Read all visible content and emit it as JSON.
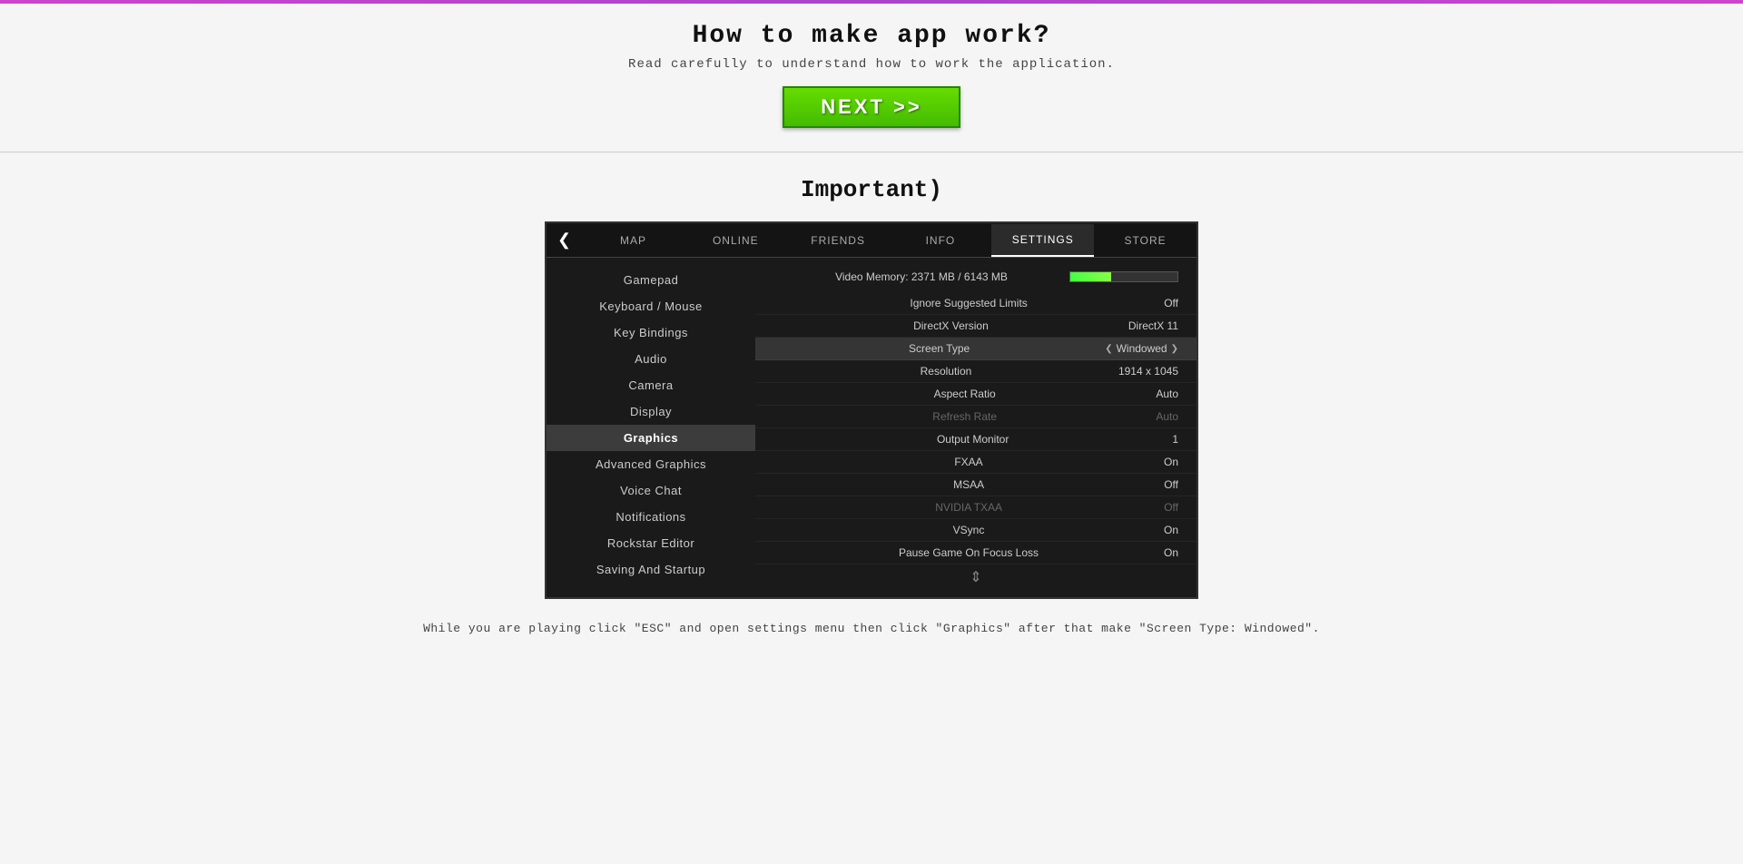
{
  "page": {
    "border_color": "#cc44cc",
    "title": "How to make app work?",
    "subtitle": "Read carefully to understand how to work the application.",
    "next_button": "NEXT >>",
    "section_title": "Important)",
    "instruction": "While you are playing click \"ESC\" and open settings menu then click \"Graphics\" after that make \"Screen Type: Windowed\"."
  },
  "nav": {
    "back_arrow": "❮",
    "items": [
      {
        "label": "MAP",
        "active": false
      },
      {
        "label": "ONLINE",
        "active": false
      },
      {
        "label": "FRIENDS",
        "active": false
      },
      {
        "label": "INFO",
        "active": false
      },
      {
        "label": "SETTINGS",
        "active": true
      },
      {
        "label": "STORE",
        "active": false
      }
    ]
  },
  "sidebar": {
    "items": [
      {
        "label": "Gamepad",
        "active": false
      },
      {
        "label": "Keyboard / Mouse",
        "active": false
      },
      {
        "label": "Key Bindings",
        "active": false
      },
      {
        "label": "Audio",
        "active": false
      },
      {
        "label": "Camera",
        "active": false
      },
      {
        "label": "Display",
        "active": false
      },
      {
        "label": "Graphics",
        "active": true
      },
      {
        "label": "Advanced Graphics",
        "active": false
      },
      {
        "label": "Voice Chat",
        "active": false
      },
      {
        "label": "Notifications",
        "active": false
      },
      {
        "label": "Rockstar Editor",
        "active": false
      },
      {
        "label": "Saving And Startup",
        "active": false
      }
    ]
  },
  "settings": {
    "vmem_label": "Video Memory: 2371 MB / 6143 MB",
    "vmem_fill_pct": 38,
    "rows": [
      {
        "label": "Ignore Suggested Limits",
        "value": "Off",
        "dimmed": false,
        "highlighted": false,
        "arrows": false
      },
      {
        "label": "DirectX Version",
        "value": "DirectX 11",
        "dimmed": false,
        "highlighted": false,
        "arrows": false
      },
      {
        "label": "Screen Type",
        "value": "Windowed",
        "dimmed": false,
        "highlighted": true,
        "arrows": true
      },
      {
        "label": "Resolution",
        "value": "1914 x 1045",
        "dimmed": false,
        "highlighted": false,
        "arrows": false
      },
      {
        "label": "Aspect Ratio",
        "value": "Auto",
        "dimmed": false,
        "highlighted": false,
        "arrows": false
      },
      {
        "label": "Refresh Rate",
        "value": "Auto",
        "dimmed": true,
        "highlighted": false,
        "arrows": false
      },
      {
        "label": "Output Monitor",
        "value": "1",
        "dimmed": false,
        "highlighted": false,
        "arrows": false
      },
      {
        "label": "FXAA",
        "value": "On",
        "dimmed": false,
        "highlighted": false,
        "arrows": false
      },
      {
        "label": "MSAA",
        "value": "Off",
        "dimmed": false,
        "highlighted": false,
        "arrows": false
      },
      {
        "label": "NVIDIA TXAA",
        "value": "Off",
        "dimmed": true,
        "highlighted": false,
        "arrows": false
      },
      {
        "label": "VSync",
        "value": "On",
        "dimmed": false,
        "highlighted": false,
        "arrows": false
      },
      {
        "label": "Pause Game On Focus Loss",
        "value": "On",
        "dimmed": false,
        "highlighted": false,
        "arrows": false
      }
    ]
  }
}
